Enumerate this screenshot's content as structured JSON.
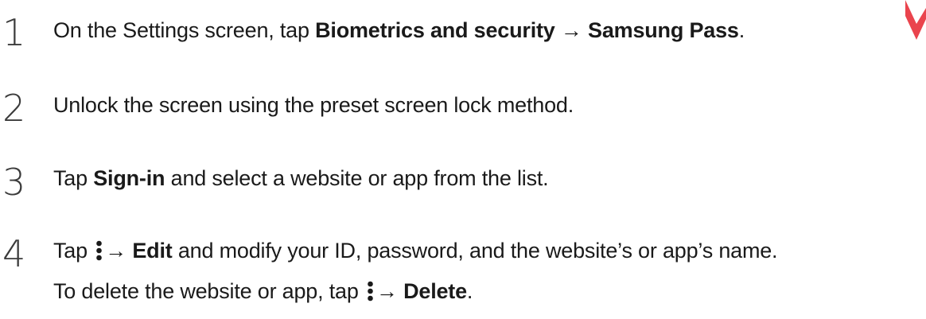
{
  "steps": [
    {
      "number": "1",
      "prefix": "On the Settings screen, tap ",
      "bold1": "Biometrics and security",
      "arrow": " → ",
      "bold2": "Samsung Pass",
      "suffix": "."
    },
    {
      "number": "2",
      "text": "Unlock the screen using the preset screen lock method."
    },
    {
      "number": "3",
      "prefix": "Tap ",
      "bold": "Sign-in",
      "suffix": " and select a website or app from the list."
    },
    {
      "number": "4",
      "prefix": "Tap ",
      "icon": "more-options-icon",
      "arrow": "→ ",
      "bold": "Edit",
      "suffix": " and modify your ID, password, and the website’s or app’s name.",
      "sub_prefix": "To delete the website or app, tap ",
      "sub_icon": "more-options-icon",
      "sub_arrow": "→ ",
      "sub_bold": "Delete",
      "sub_suffix": "."
    }
  ],
  "colors": {
    "text": "#1a1a1a",
    "number": "#3b3b3b",
    "watermark": "#e8303a"
  }
}
